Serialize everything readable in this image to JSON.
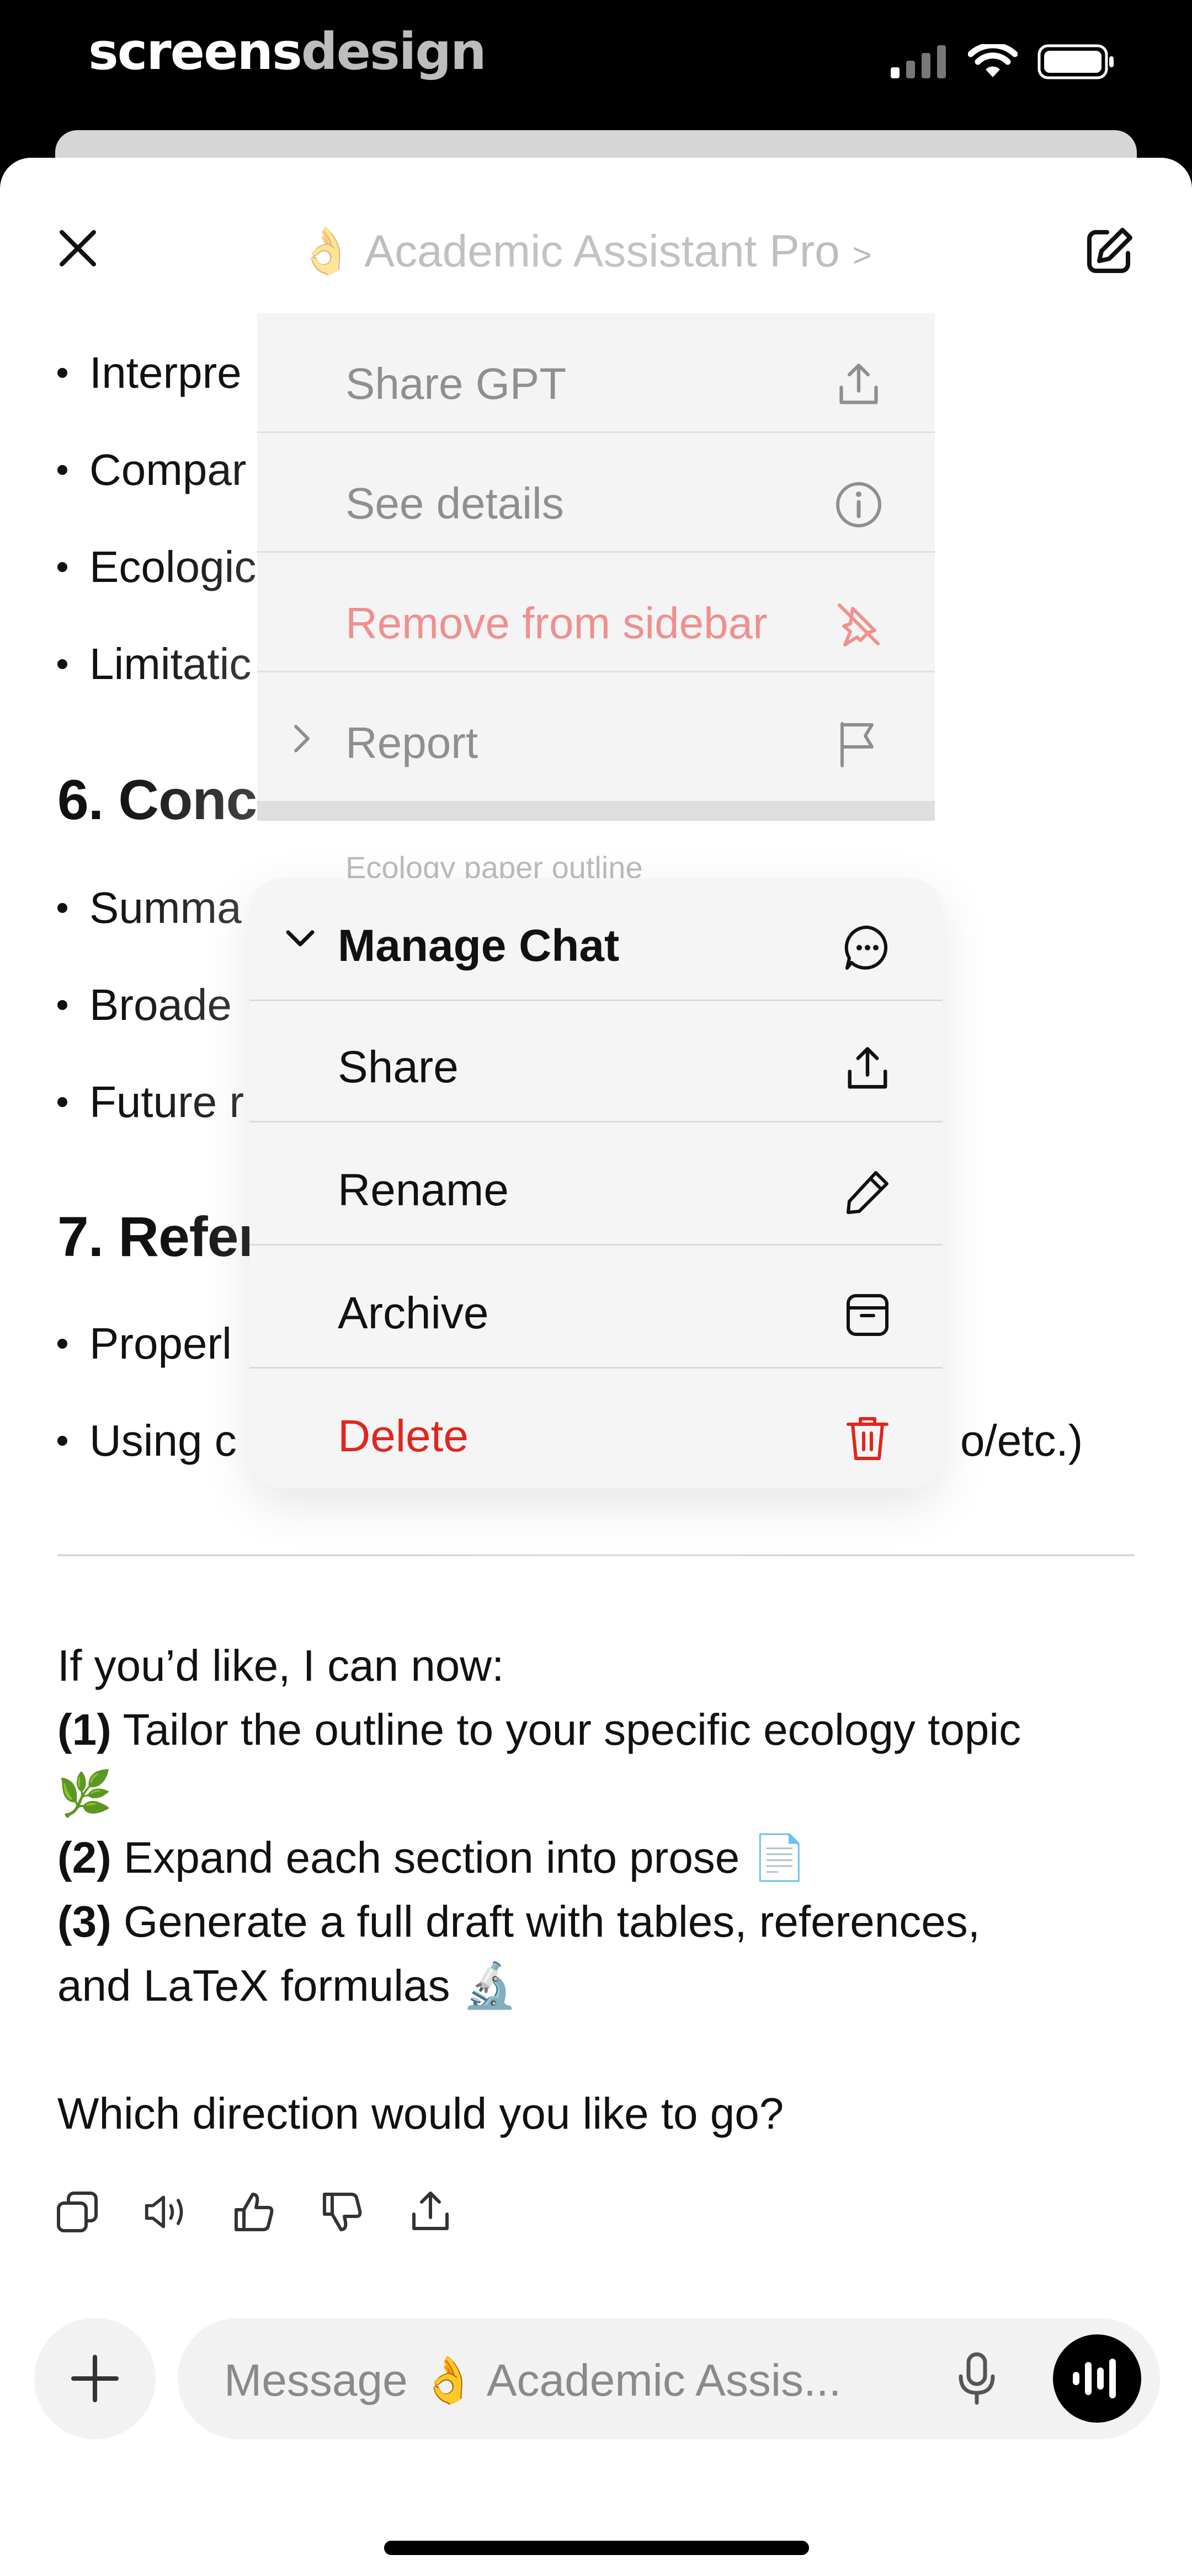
{
  "status_bar": {
    "brand_part1": "screens",
    "brand_part2": "design"
  },
  "header": {
    "title_emoji": "👌",
    "title": "Academic Assistant Pro",
    "title_chevron": ">"
  },
  "chat": {
    "bullets_top": [
      "Interpre",
      "Compar",
      "Ecologic",
      "Limitatic"
    ],
    "heading_6": "6. Conc",
    "bullets_mid": [
      "Summa",
      "Broade",
      "Future r"
    ],
    "heading_7": "7. Refer",
    "bullets_bottom": [
      "Properl",
      "Using c"
    ],
    "bullet_tail": "o/etc.)",
    "offer_intro": "If you’d like, I can now:",
    "offer_1_num": "(1)",
    "offer_1_text": " Tailor the outline to your specific ecology topic",
    "offer_1_emoji": "🌿",
    "offer_2_num": "(2)",
    "offer_2_text": " Expand each section into prose ",
    "offer_2_emoji": "📄",
    "offer_3_num": "(3)",
    "offer_3_text": " Generate a full draft with tables, references,",
    "offer_3_line2": "and LaTeX formulas ",
    "offer_3_emoji": "🔬",
    "question": "Which direction would you like to go?"
  },
  "message_actions": [
    "copy-icon",
    "read-aloud-icon",
    "thumbs-up-icon",
    "thumbs-down-icon",
    "share-icon"
  ],
  "composer": {
    "placeholder": "Message 👌 Academic Assis..."
  },
  "gpt_menu": {
    "items": [
      {
        "label": "Share GPT",
        "icon": "share-icon"
      },
      {
        "label": "See details",
        "icon": "info-icon"
      },
      {
        "label": "Remove from sidebar",
        "icon": "unpin-icon",
        "color": "#f08f8f"
      },
      {
        "label": "Report",
        "icon": "flag-icon"
      }
    ],
    "subtitle": "Ecology paper outline"
  },
  "chat_menu": {
    "items": [
      {
        "label": "Manage Chat",
        "icon": "chat-bubble-icon"
      },
      {
        "label": "Share",
        "icon": "share-icon"
      },
      {
        "label": "Rename",
        "icon": "pencil-icon"
      },
      {
        "label": "Archive",
        "icon": "archive-icon"
      },
      {
        "label": "Delete",
        "icon": "trash-icon",
        "color": "#e0261e"
      }
    ]
  }
}
